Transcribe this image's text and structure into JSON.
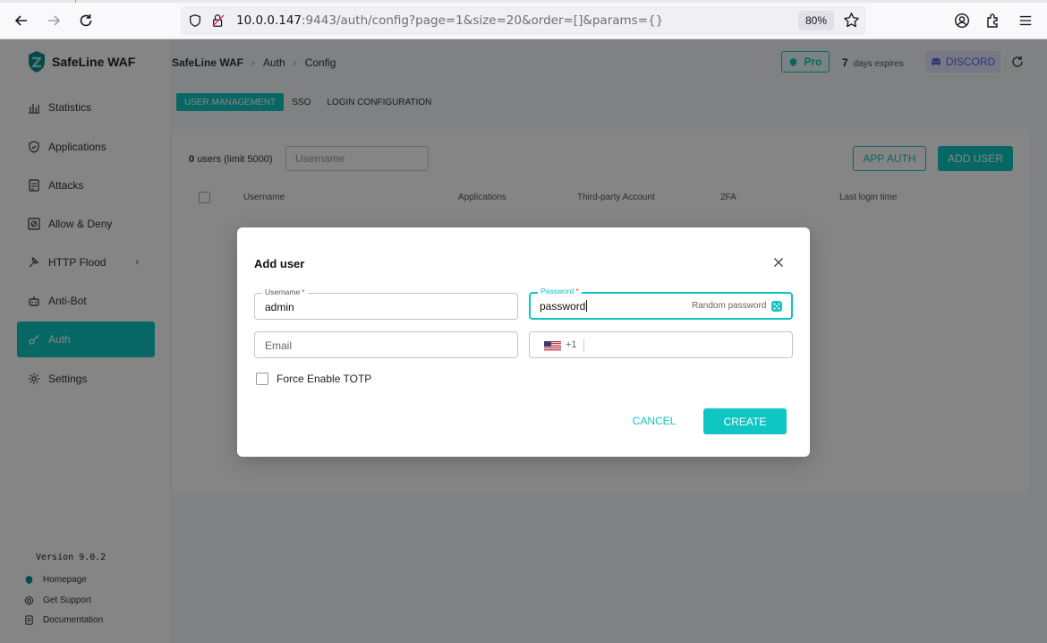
{
  "browser": {
    "url_host": "10.0.0.147",
    "url_rest": ":9443/auth/config?page=1&size=20&order=[]&params={}",
    "zoom": "80%"
  },
  "app": {
    "logo_text": "SafeLine WAF",
    "accent_color": "#0fc6c2",
    "menu": [
      {
        "label": "Statistics",
        "icon": "bar-chart-icon"
      },
      {
        "label": "Applications",
        "icon": "shield-icon"
      },
      {
        "label": "Attacks",
        "icon": "document-icon"
      },
      {
        "label": "Allow & Deny",
        "icon": "block-list-icon"
      },
      {
        "label": "HTTP Flood",
        "icon": "hammer-icon",
        "has_submenu": true
      },
      {
        "label": "Anti-Bot",
        "icon": "robot-icon"
      },
      {
        "label": "Auth",
        "icon": "key-icon",
        "active": true
      },
      {
        "label": "Settings",
        "icon": "gear-icon"
      }
    ],
    "version": "Version 9.0.2",
    "footer_links": [
      {
        "label": "Homepage",
        "icon": "shield-home-icon"
      },
      {
        "label": "Get Support",
        "icon": "support-icon"
      },
      {
        "label": "Documentation",
        "icon": "doc-icon"
      }
    ]
  },
  "header": {
    "breadcrumb": [
      "SafeLine WAF",
      "Auth",
      "Config"
    ],
    "pro_label": "Pro",
    "expire_days": "7",
    "expire_text": "days expires",
    "discord_label": "DISCORD"
  },
  "tabs": [
    "USER MANAGEMENT",
    "SSO",
    "LOGIN CONFIGURATION"
  ],
  "user_panel": {
    "count": "0",
    "count_text": "users (limit 5000)",
    "search_placeholder": "Username",
    "app_auth_label": "APP AUTH",
    "add_user_label": "ADD USER",
    "columns": [
      "Username",
      "Applications",
      "Third-party Account",
      "2FA",
      "Last login time"
    ]
  },
  "dialog": {
    "title": "Add user",
    "username_label": "Username",
    "username_value": "admin",
    "password_label": "Password",
    "password_value": "password",
    "random_password_label": "Random password",
    "email_placeholder": "Email",
    "phone_dial_code": "+1",
    "totp_label": "Force Enable TOTP",
    "totp_checked": false,
    "cancel_label": "CANCEL",
    "create_label": "CREATE"
  }
}
